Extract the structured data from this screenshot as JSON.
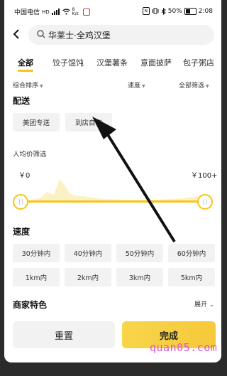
{
  "status_bar": {
    "carrier": "中国电信",
    "hd": "HD",
    "net_speed": "8 K/s",
    "battery": "50%",
    "time": "2:08"
  },
  "search": {
    "query": "华莱士·全鸡汉堡"
  },
  "tabs": [
    {
      "label": "全部"
    },
    {
      "label": "饺子馄饨"
    },
    {
      "label": "汉堡薯条"
    },
    {
      "label": "意面披萨"
    },
    {
      "label": "包子粥店"
    }
  ],
  "sorts": {
    "overall": "综合排序",
    "speed": "速度",
    "all_filter": "全部筛选"
  },
  "delivery": {
    "title": "配送",
    "options": [
      "美团专送",
      "到店自取"
    ]
  },
  "price": {
    "title": "人均价筛选",
    "min": "￥0",
    "max": "￥100+"
  },
  "speed": {
    "title": "速度",
    "time_options": [
      "30分钟内",
      "40分钟内",
      "50分钟内",
      "60分钟内"
    ],
    "distance_options": [
      "1km内",
      "2km内",
      "3km内",
      "5km内"
    ]
  },
  "merchant": {
    "title": "商家特色",
    "expand": "展开"
  },
  "buttons": {
    "reset": "重置",
    "done": "完成"
  },
  "watermark": "quan05.com",
  "colors": {
    "accent": "#f5c518",
    "chip_bg": "#f2f2f2",
    "watermark": "#e252d6"
  }
}
